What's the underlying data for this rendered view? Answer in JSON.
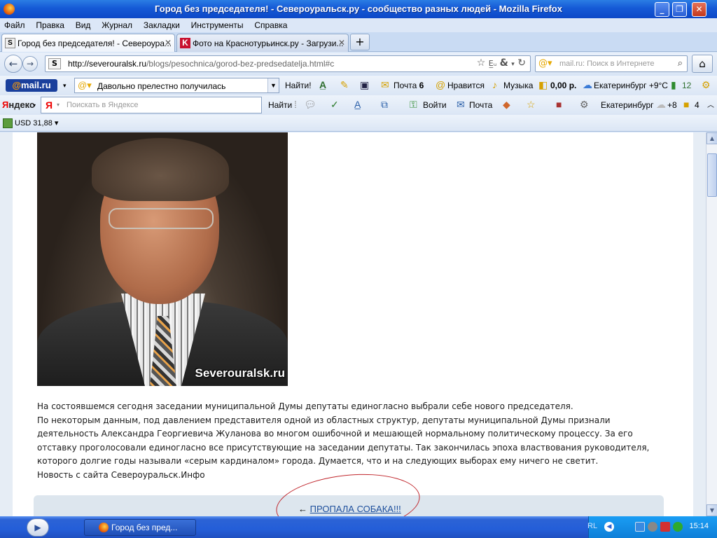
{
  "window": {
    "title": "Город без председателя! - Североуральск.ру - сообщество разных людей - Mozilla Firefox"
  },
  "menu": [
    "Файл",
    "Правка",
    "Вид",
    "Журнал",
    "Закладки",
    "Инструменты",
    "Справка"
  ],
  "tabs": [
    {
      "label": "Город без председателя! - Североура...",
      "active": true
    },
    {
      "label": "Фото на Краснотурьинск.ру - Загрузи...",
      "active": false
    }
  ],
  "navbar": {
    "url_domain": "http://severouralsk.ru",
    "url_path": "/blogs/pesochnica/gorod-bez-predsedatelja.html#c",
    "search_placeholder": "mail.ru: Поиск в Интернете"
  },
  "mailbar": {
    "logo_at": "@",
    "logo_text": "mail.ru",
    "search_value": "Давольно прелестно получилась",
    "find_label": "Найти!",
    "mail_label": "Почта",
    "mail_count": "6",
    "likes_label": "Нравится",
    "music_label": "Музыка",
    "money": "0,00 р.",
    "weather": "Екатеринбург +9°C",
    "traffic": "12"
  },
  "yabar": {
    "logo_first": "Я",
    "logo_rest": "ндекс",
    "search_glyph": "Я",
    "search_placeholder": "Поискать в Яндексе",
    "find_label": "Найти",
    "login_label": "Войти",
    "mail_label": "Почта",
    "city": "Екатеринбург",
    "temp": "+8",
    "count": "4"
  },
  "curbar": {
    "usd": "USD 31,88"
  },
  "photo": {
    "watermark": "Severouralsk.ru"
  },
  "article": {
    "p1": "На состоявшемся сегодня заседании муниципальной Думы депутаты единогласно выбрали себе нового председателя.",
    "p2": "По некоторым данным, под давлением представителя одной из областных структур, депутаты муниципальной Думы признали деятельность Александра Георгиевича Жуланова во многом ошибочной и мешающей нормальному политическому процессу. За его отставку проголосовали единогласно все присутствующие на заседании депутаты. Так закончилась эпоха властвования руководителя, которого долгие годы называли «серым кардиналом» города. Думается, что и на следующих выборах ему ничего не светит.",
    "p3": "Новость с сайта Североуральск.Инфо"
  },
  "prev_link": {
    "arrow": "←",
    "label": "ПРОПАЛА СОБАКА!!!"
  },
  "taskbar": {
    "task_label": "Город без пред...",
    "lang": "RL",
    "clock": "15:14"
  }
}
